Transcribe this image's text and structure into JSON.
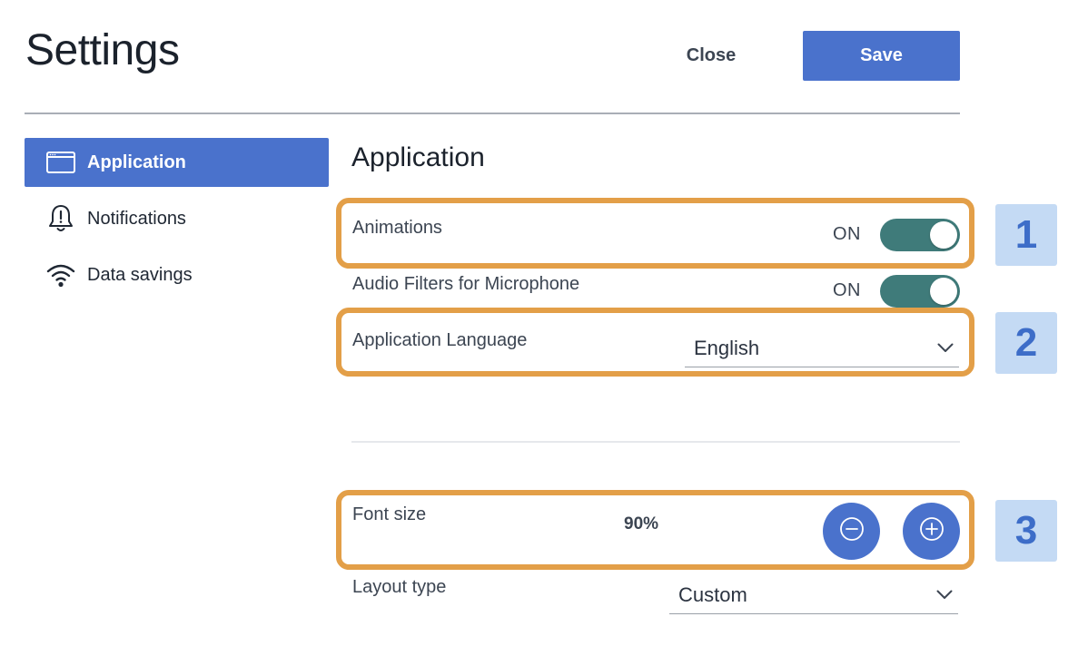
{
  "header": {
    "title": "Settings",
    "close_label": "Close",
    "save_label": "Save"
  },
  "sidebar": {
    "items": [
      {
        "label": "Application",
        "icon": "browser-window-icon",
        "active": true
      },
      {
        "label": "Notifications",
        "icon": "bell-alert-icon",
        "active": false
      },
      {
        "label": "Data savings",
        "icon": "wifi-icon",
        "active": false
      }
    ]
  },
  "main": {
    "section_title": "Application",
    "animations": {
      "label": "Animations",
      "state": "ON"
    },
    "audio_filters": {
      "label": "Audio Filters for Microphone",
      "state": "ON"
    },
    "language": {
      "label": "Application Language",
      "value": "English"
    },
    "font_size": {
      "label": "Font size",
      "value": "90%"
    },
    "layout_type": {
      "label": "Layout type",
      "value": "Custom"
    }
  },
  "callouts": [
    "1",
    "2",
    "3"
  ],
  "colors": {
    "accent": "#4a72cc",
    "toggle_on": "#3f7b7a",
    "highlight": "#e39f48",
    "badge_bg": "#c4daf4",
    "badge_text": "#3d6dc8"
  }
}
